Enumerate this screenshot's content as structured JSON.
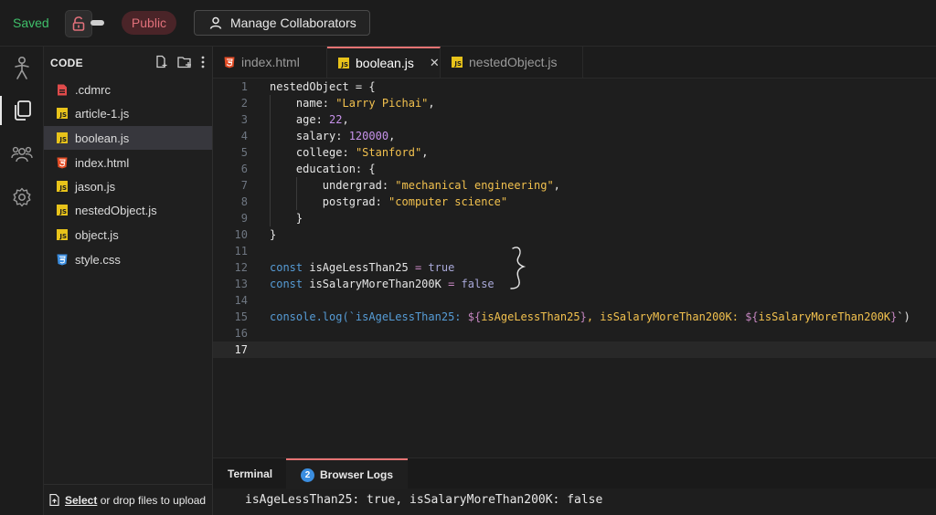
{
  "topbar": {
    "saved_label": "Saved",
    "public_label": "Public",
    "manage_label": "Manage Collaborators"
  },
  "activity_icons": [
    "runner-icon",
    "files-icon",
    "collaborators-icon",
    "settings-icon"
  ],
  "sidebar": {
    "title": "CODE",
    "files": [
      {
        "name": ".cdmrc",
        "type": "config"
      },
      {
        "name": "article-1.js",
        "type": "js"
      },
      {
        "name": "boolean.js",
        "type": "js",
        "active": true
      },
      {
        "name": "index.html",
        "type": "html"
      },
      {
        "name": "jason.js",
        "type": "js"
      },
      {
        "name": "nestedObject.js",
        "type": "js"
      },
      {
        "name": "object.js",
        "type": "js"
      },
      {
        "name": "style.css",
        "type": "css"
      }
    ],
    "upload_link": "Select",
    "upload_rest": "or drop files to upload"
  },
  "tabs": [
    {
      "label": "index.html",
      "type": "html"
    },
    {
      "label": "boolean.js",
      "type": "js",
      "active": true
    },
    {
      "label": "nestedObject.js",
      "type": "js"
    }
  ],
  "editor": {
    "line_numbers": [
      "1",
      "2",
      "3",
      "4",
      "5",
      "6",
      "7",
      "8",
      "9",
      "10",
      "11",
      "12",
      "13",
      "14",
      "15",
      "16",
      "17"
    ],
    "current_line": "17",
    "code": {
      "l1": "nestedObject = {",
      "l2_key": "name: ",
      "l2_val": "\"Larry Pichai\"",
      "l2_end": ",",
      "l3_key": "age: ",
      "l3_val": "22",
      "l3_end": ",",
      "l4_key": "salary: ",
      "l4_val": "120000",
      "l4_end": ",",
      "l5_key": "college: ",
      "l5_val": "\"Stanford\"",
      "l5_end": ",",
      "l6": "education: {",
      "l7_key": "undergrad: ",
      "l7_val": "\"mechanical engineering\"",
      "l7_end": ",",
      "l8_key": "postgrad: ",
      "l8_val": "\"computer science\"",
      "l9": "}",
      "l10": "}",
      "l12_kw": "const",
      "l12_name": " isAgeLessThan25 ",
      "l12_op": "=",
      "l12_val": " true",
      "l13_kw": "const",
      "l13_name": " isSalaryMoreThan200K ",
      "l13_op": "=",
      "l13_val": " false",
      "l15_a": "console.log(`isAgeLessThan25: ",
      "l15_b": "${",
      "l15_c": "isAgeLessThan25",
      "l15_d": "}",
      "l15_e": ", isSalaryMoreThan200K: ",
      "l15_f": "${",
      "l15_g": "isSalaryMoreThan200K",
      "l15_h": "}",
      "l15_i": "`)"
    }
  },
  "terminal": {
    "tab_terminal": "Terminal",
    "tab_browser_logs": "Browser Logs",
    "browser_logs_count": "2",
    "output": "isAgeLessThan25: true, isSalaryMoreThan200K: false"
  },
  "colors": {
    "saved": "#3fbf6a",
    "public_text": "#e0707a",
    "accent": "#e57373",
    "js_icon": "#e8c31a",
    "html_icon": "#e44d26",
    "css_icon": "#3b8ee0",
    "string": "#f2c14e",
    "number": "#c792ea",
    "keyword": "#569cd6"
  }
}
